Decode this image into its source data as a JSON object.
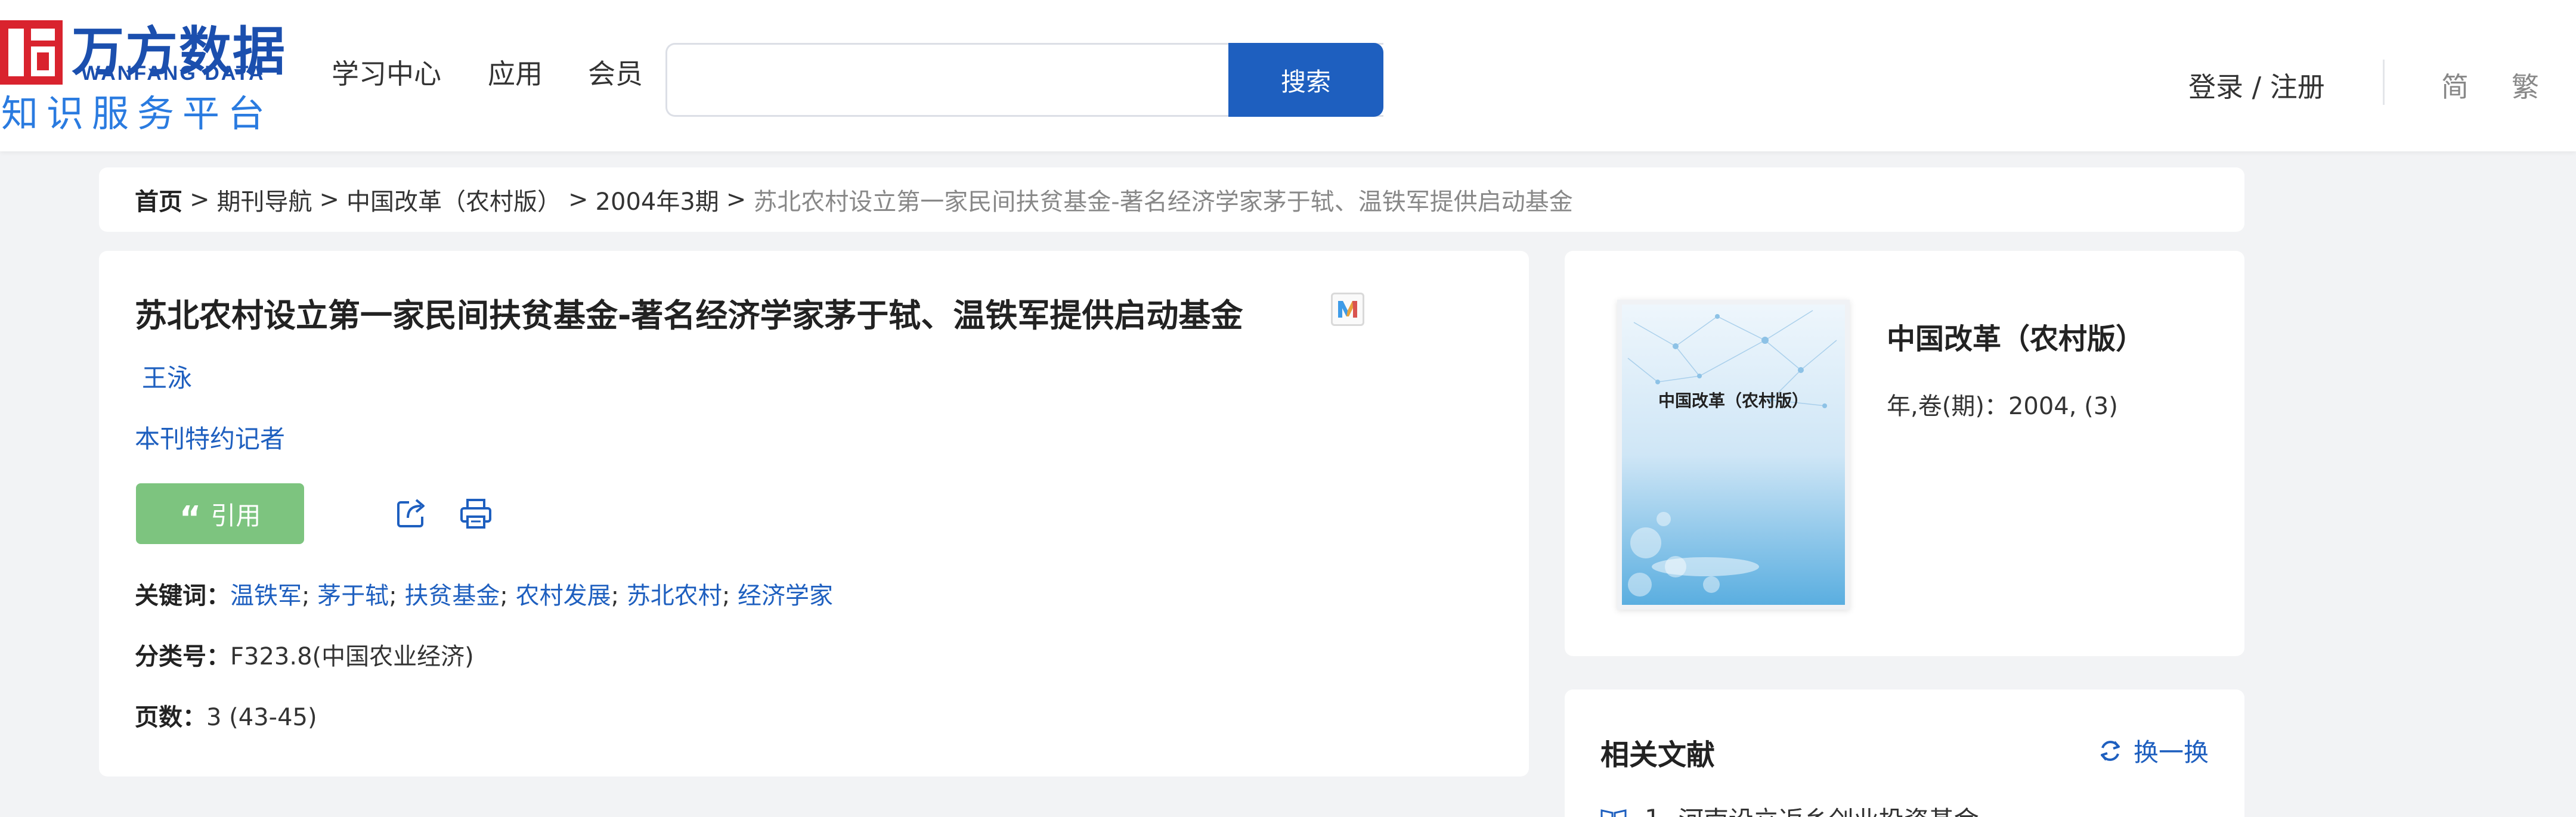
{
  "header": {
    "logo": {
      "name_cn": "万方数据",
      "name_en": "WANFANG DATA",
      "subtitle": "知识服务平台"
    },
    "nav": [
      "学习中心",
      "应用",
      "会员"
    ],
    "search": {
      "placeholder": "",
      "button_label": "搜索"
    },
    "login_label": "登录 / 注册",
    "lang_simplified": "简",
    "lang_traditional": "繁"
  },
  "breadcrumb": {
    "home": "首页",
    "separator": ">",
    "items": [
      "期刊导航",
      "中国改革（农村版）",
      "2004年3期"
    ],
    "current": "苏北农村设立第一家民间扶贫基金-著名经济学家茅于轼、温铁军提供启动基金"
  },
  "article": {
    "title": "苏北农村设立第一家民间扶贫基金-著名经济学家茅于轼、温铁军提供启动基金",
    "badge": "M",
    "author": "王泳",
    "organization": "本刊特约记者",
    "cite_label": "引用",
    "keywords_label": "关键词：",
    "keywords": [
      "温铁军",
      "茅于轼",
      "扶贫基金",
      "农村发展",
      "苏北农村",
      "经济学家"
    ],
    "keyword_separator": ";",
    "classification_label": "分类号：",
    "classification": "F323.8(中国农业经济)",
    "pages_label": "页数：",
    "pages": "3 (43-45)"
  },
  "journal": {
    "cover_title": "中国改革（农村版）",
    "name": "中国改革（农村版）",
    "year_volume_label": "年,卷(期)：",
    "year_volume": "2004, (3)"
  },
  "related": {
    "title": "相关文献",
    "refresh_label": "换一换",
    "items": [
      {
        "index": "1",
        "title": "河南设立返乡创业投资基金"
      }
    ]
  },
  "colors": {
    "brand_blue": "#1b4fae",
    "link_blue": "#1e5fbf",
    "cite_green": "#7dc47f",
    "logo_red": "#d9232e"
  }
}
